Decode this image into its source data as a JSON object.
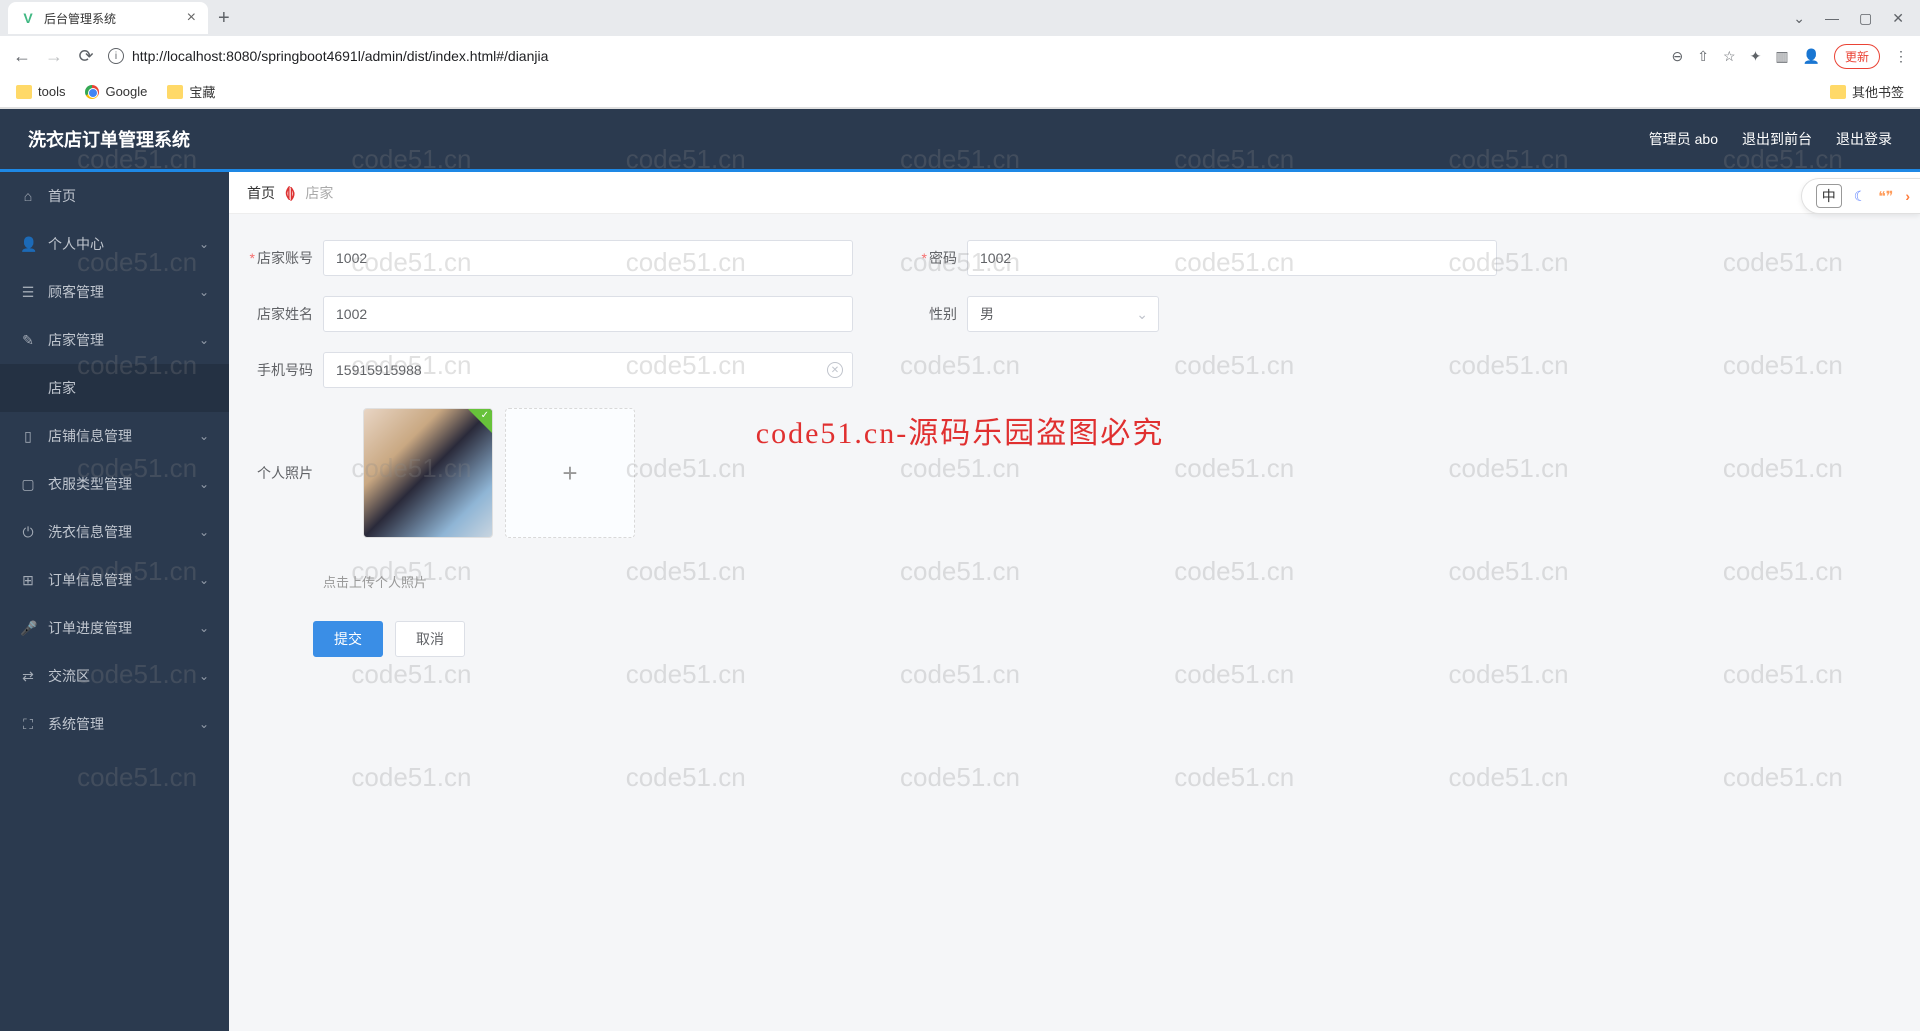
{
  "browser": {
    "tab_title": "后台管理系统",
    "url": "http://localhost:8080/springboot4691l/admin/dist/index.html#/dianjia",
    "update_label": "更新",
    "bookmarks": {
      "tools": "tools",
      "google": "Google",
      "treasure": "宝藏",
      "other": "其他书签"
    }
  },
  "header": {
    "title": "洗衣店订单管理系统",
    "admin": "管理员 abo",
    "to_front": "退出到前台",
    "logout": "退出登录"
  },
  "sidebar": {
    "home": "首页",
    "personal": "个人中心",
    "customer": "顾客管理",
    "shop": "店家管理",
    "shop_sub": "店家",
    "store_info": "店铺信息管理",
    "clothes_type": "衣服类型管理",
    "wash_info": "洗衣信息管理",
    "order_info": "订单信息管理",
    "order_progress": "订单进度管理",
    "forum": "交流区",
    "system": "系统管理"
  },
  "breadcrumb": {
    "home": "首页",
    "current": "店家"
  },
  "form": {
    "account_label": "店家账号",
    "account_value": "1002",
    "password_label": "密码",
    "password_value": "1002",
    "name_label": "店家姓名",
    "name_value": "1002",
    "gender_label": "性别",
    "gender_value": "男",
    "phone_label": "手机号码",
    "phone_value": "15915915988",
    "photo_label": "个人照片",
    "upload_hint": "点击上传个人照片",
    "submit": "提交",
    "cancel": "取消"
  },
  "watermark": {
    "text": "code51.cn",
    "banner": "code51.cn-源码乐园盗图必究"
  },
  "floatbar": {
    "lang": "中"
  }
}
